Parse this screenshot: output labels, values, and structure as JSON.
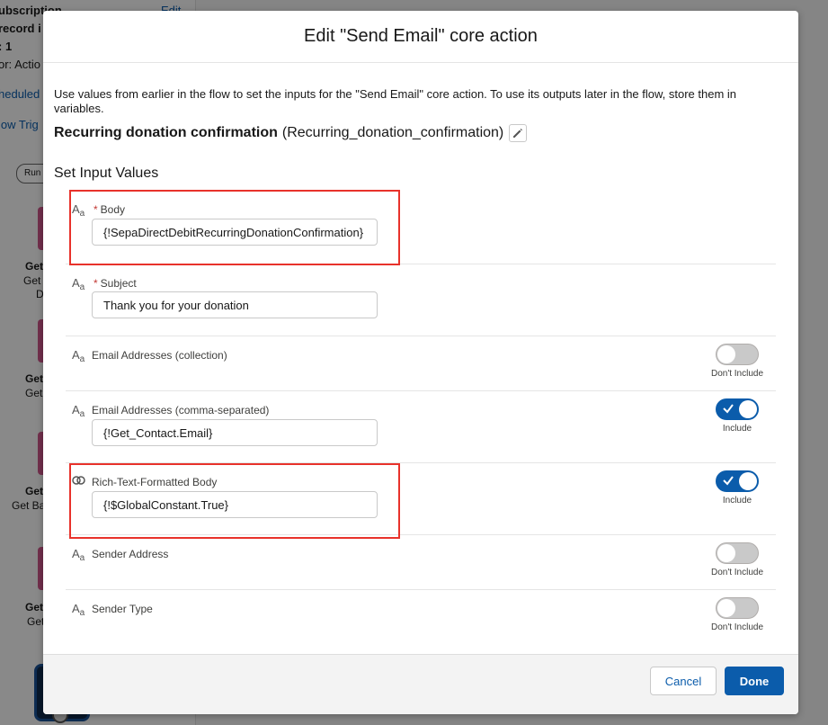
{
  "background": {
    "panel_lines": [
      "ubscription",
      "record i",
      ": 1",
      "or: Actio"
    ],
    "panel_edit_link": "Edit",
    "scheduled_link": "heduled",
    "flow_trigger_link": "low Trig",
    "run_pill": "Run",
    "nodes": [
      {
        "title": "Get",
        "sub1": "Get",
        "sub2": "D"
      },
      {
        "title": "Get",
        "sub1": "Get"
      },
      {
        "title": "Get",
        "sub1": "Get Ba"
      },
      {
        "title": "Get",
        "sub1": "Get"
      }
    ]
  },
  "modal": {
    "title": "Edit \"Send Email\" core action",
    "intro": "Use values from earlier in the flow to set the inputs for the \"Send Email\" core action. To use its outputs later in the flow, store them in variables.",
    "action_label": "Recurring donation confirmation",
    "action_api_name": "(Recurring_donation_confirmation)",
    "section_title": "Set Input Values",
    "fields": {
      "body": {
        "label": "Body",
        "required_mark": "*",
        "value": "{!SepaDirectDebitRecurringDonationConfirmation}",
        "icon": "text-type-icon"
      },
      "subject": {
        "label": "Subject",
        "required_mark": "*",
        "value": "Thank you for your donation",
        "icon": "text-type-icon"
      },
      "email_collection": {
        "label": "Email Addresses (collection)",
        "toggle": "Don't Include",
        "icon": "text-type-icon"
      },
      "email_csv": {
        "label": "Email Addresses (comma-separated)",
        "value": "{!Get_Contact.Email}",
        "toggle": "Include",
        "icon": "text-type-icon"
      },
      "rich_text": {
        "label": "Rich-Text-Formatted Body",
        "value": "{!$GlobalConstant.True}",
        "toggle": "Include",
        "icon": "boolean-type-icon"
      },
      "sender_address": {
        "label": "Sender Address",
        "toggle": "Don't Include",
        "icon": "text-type-icon"
      },
      "sender_type": {
        "label": "Sender Type",
        "toggle": "Don't Include",
        "icon": "text-type-icon"
      }
    },
    "type_icon_glyph": {
      "big": "A",
      "small": "a"
    },
    "footer": {
      "cancel": "Cancel",
      "done": "Done"
    }
  },
  "colors": {
    "brand": "#0b5cab",
    "highlight": "#e8322b",
    "required": "#c23934"
  }
}
